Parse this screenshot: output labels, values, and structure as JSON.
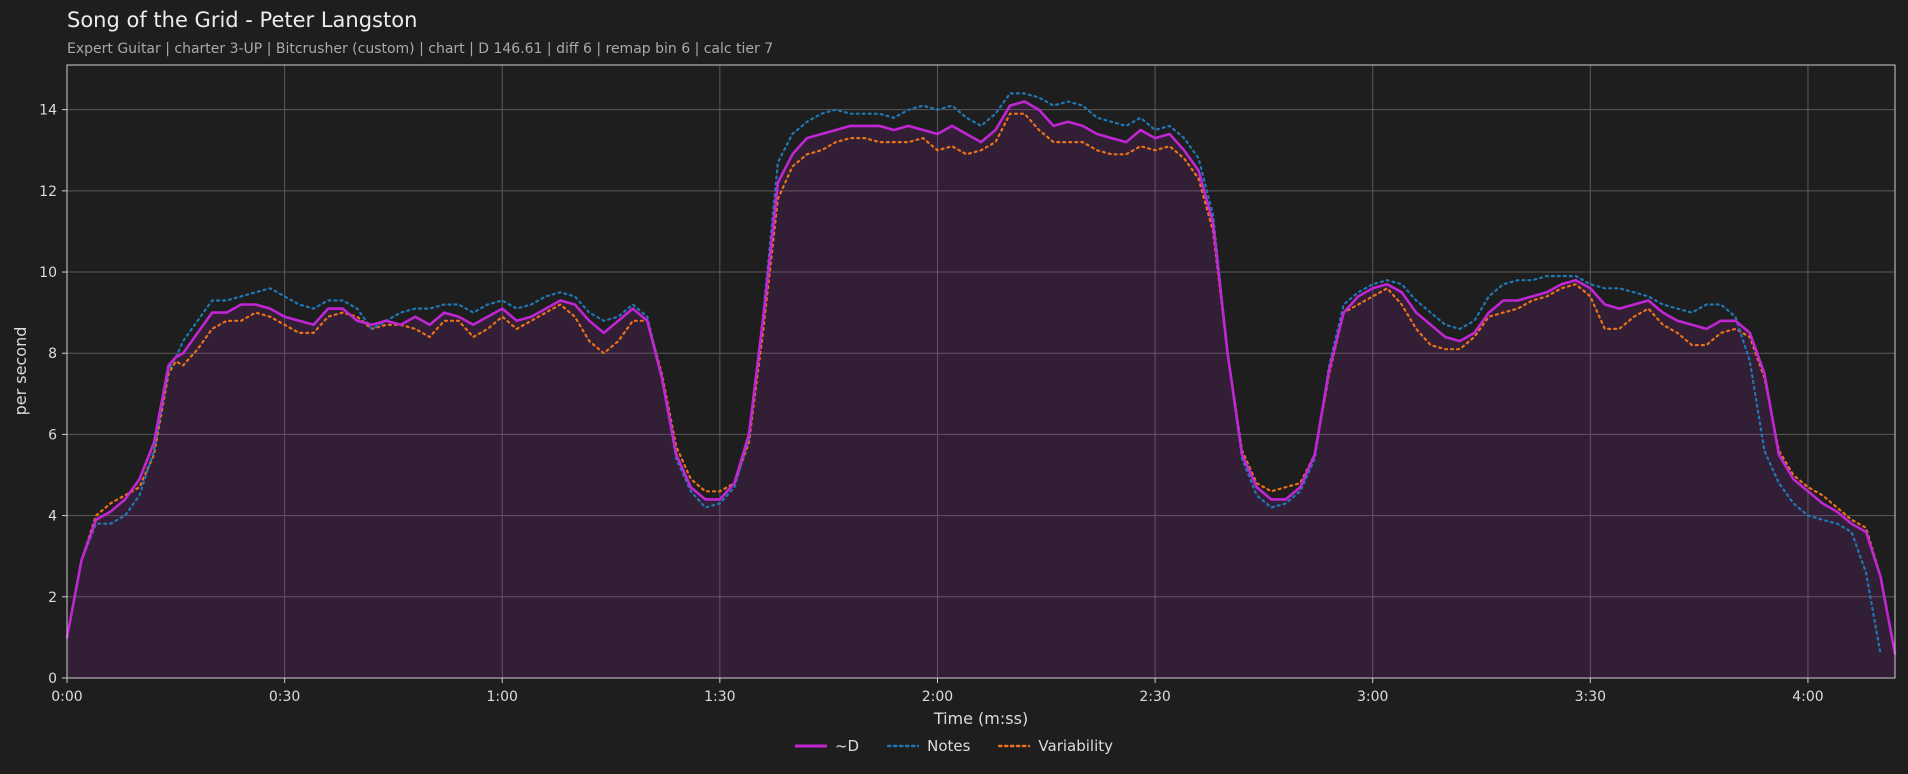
{
  "title": "Song of the Grid - Peter Langston",
  "subtitle": "Expert Guitar  |  charter 3-UP  |  Bitcrusher (custom)  |  chart  |  D 146.61  |  diff 6  |  remap bin 6  |  calc tier 7",
  "chart_data": {
    "type": "line",
    "xlabel": "Time (m:ss)",
    "ylabel": "per second",
    "xlim": [
      0,
      252
    ],
    "ylim": [
      0,
      15.1
    ],
    "x_ticks": [
      0,
      30,
      60,
      90,
      120,
      150,
      180,
      210,
      240
    ],
    "x_tick_labels": [
      "0:00",
      "0:30",
      "1:00",
      "1:30",
      "2:00",
      "2:30",
      "3:00",
      "3:30",
      "4:00"
    ],
    "y_ticks": [
      0,
      2,
      4,
      6,
      8,
      10,
      12,
      14
    ],
    "y_tick_labels": [
      "0",
      "2",
      "4",
      "6",
      "8",
      "10",
      "12",
      "14"
    ],
    "grid": true,
    "legend_position": "bottom-center",
    "x": [
      0,
      2,
      4,
      6,
      8,
      10,
      12,
      14,
      15,
      16,
      18,
      20,
      22,
      24,
      26,
      28,
      30,
      32,
      34,
      36,
      38,
      40,
      42,
      44,
      46,
      48,
      50,
      52,
      54,
      56,
      58,
      60,
      62,
      64,
      66,
      68,
      70,
      72,
      74,
      76,
      78,
      80,
      82,
      84,
      86,
      88,
      90,
      92,
      94,
      96,
      98,
      100,
      102,
      104,
      106,
      108,
      110,
      112,
      114,
      116,
      118,
      120,
      122,
      124,
      126,
      128,
      130,
      132,
      134,
      136,
      138,
      140,
      142,
      144,
      146,
      148,
      150,
      152,
      154,
      156,
      158,
      160,
      162,
      164,
      166,
      168,
      170,
      172,
      174,
      176,
      178,
      180,
      182,
      184,
      186,
      188,
      190,
      192,
      194,
      196,
      198,
      200,
      202,
      204,
      206,
      208,
      210,
      212,
      214,
      216,
      218,
      220,
      222,
      224,
      226,
      228,
      230,
      232,
      234,
      236,
      238,
      240,
      242,
      244,
      246,
      248,
      250,
      252
    ],
    "series": [
      {
        "name": "~D",
        "style": "solid",
        "color": "#c026d3",
        "values": [
          1.0,
          2.9,
          3.9,
          4.1,
          4.4,
          4.9,
          5.8,
          7.7,
          7.9,
          8.0,
          8.5,
          9.0,
          9.0,
          9.2,
          9.2,
          9.1,
          8.9,
          8.8,
          8.7,
          9.1,
          9.1,
          8.8,
          8.7,
          8.8,
          8.7,
          8.9,
          8.7,
          9.0,
          8.9,
          8.7,
          8.9,
          9.1,
          8.8,
          8.9,
          9.1,
          9.3,
          9.2,
          8.8,
          8.5,
          8.8,
          9.1,
          8.8,
          7.4,
          5.5,
          4.7,
          4.4,
          4.4,
          4.8,
          6.0,
          8.9,
          12.2,
          12.9,
          13.3,
          13.4,
          13.5,
          13.6,
          13.6,
          13.6,
          13.5,
          13.6,
          13.5,
          13.4,
          13.6,
          13.4,
          13.2,
          13.5,
          14.1,
          14.2,
          14.0,
          13.6,
          13.7,
          13.6,
          13.4,
          13.3,
          13.2,
          13.5,
          13.3,
          13.4,
          13.0,
          12.5,
          11.2,
          8.0,
          5.5,
          4.7,
          4.4,
          4.4,
          4.7,
          5.5,
          7.6,
          9.0,
          9.4,
          9.6,
          9.7,
          9.5,
          9.0,
          8.7,
          8.4,
          8.3,
          8.5,
          9.0,
          9.3,
          9.3,
          9.4,
          9.5,
          9.7,
          9.8,
          9.6,
          9.2,
          9.1,
          9.2,
          9.3,
          9.0,
          8.8,
          8.7,
          8.6,
          8.8,
          8.8,
          8.5,
          7.5,
          5.5,
          4.9,
          4.6,
          4.3,
          4.1,
          3.8,
          3.6,
          2.5,
          0.6
        ]
      },
      {
        "name": "Notes",
        "style": "dotted",
        "color": "#1f77b4",
        "values": [
          1.0,
          2.9,
          3.8,
          3.8,
          4.0,
          4.5,
          5.6,
          7.6,
          7.9,
          8.3,
          8.8,
          9.3,
          9.3,
          9.4,
          9.5,
          9.6,
          9.4,
          9.2,
          9.1,
          9.3,
          9.3,
          9.1,
          8.6,
          8.8,
          9.0,
          9.1,
          9.1,
          9.2,
          9.2,
          9.0,
          9.2,
          9.3,
          9.1,
          9.2,
          9.4,
          9.5,
          9.4,
          9.0,
          8.8,
          8.9,
          9.2,
          8.9,
          7.4,
          5.4,
          4.6,
          4.2,
          4.3,
          4.7,
          5.9,
          9.0,
          12.7,
          13.4,
          13.7,
          13.9,
          14.0,
          13.9,
          13.9,
          13.9,
          13.8,
          14.0,
          14.1,
          14.0,
          14.1,
          13.8,
          13.6,
          13.9,
          14.4,
          14.4,
          14.3,
          14.1,
          14.2,
          14.1,
          13.8,
          13.7,
          13.6,
          13.8,
          13.5,
          13.6,
          13.3,
          12.8,
          11.4,
          8.0,
          5.4,
          4.5,
          4.2,
          4.3,
          4.6,
          5.4,
          7.7,
          9.2,
          9.5,
          9.7,
          9.8,
          9.7,
          9.3,
          9.0,
          8.7,
          8.6,
          8.8,
          9.4,
          9.7,
          9.8,
          9.8,
          9.9,
          9.9,
          9.9,
          9.7,
          9.6,
          9.6,
          9.5,
          9.4,
          9.2,
          9.1,
          9.0,
          9.2,
          9.2,
          8.9,
          7.8,
          5.6,
          4.8,
          4.3,
          4.0,
          3.9,
          3.8,
          3.6,
          2.6,
          0.6
        ]
      },
      {
        "name": "Variability",
        "style": "dotted",
        "color": "#e8711a",
        "values": [
          1.0,
          2.9,
          4.0,
          4.3,
          4.5,
          4.7,
          5.5,
          7.5,
          7.8,
          7.7,
          8.1,
          8.6,
          8.8,
          8.8,
          9.0,
          8.9,
          8.7,
          8.5,
          8.5,
          8.9,
          9.0,
          8.9,
          8.6,
          8.7,
          8.7,
          8.6,
          8.4,
          8.8,
          8.8,
          8.4,
          8.6,
          8.9,
          8.6,
          8.8,
          9.0,
          9.2,
          8.9,
          8.3,
          8.0,
          8.3,
          8.8,
          8.8,
          7.5,
          5.7,
          4.9,
          4.6,
          4.6,
          4.8,
          5.8,
          8.6,
          11.8,
          12.6,
          12.9,
          13.0,
          13.2,
          13.3,
          13.3,
          13.2,
          13.2,
          13.2,
          13.3,
          13.0,
          13.1,
          12.9,
          13.0,
          13.2,
          13.9,
          13.9,
          13.5,
          13.2,
          13.2,
          13.2,
          13.0,
          12.9,
          12.9,
          13.1,
          13.0,
          13.1,
          12.8,
          12.3,
          11.0,
          8.0,
          5.6,
          4.8,
          4.6,
          4.7,
          4.8,
          5.5,
          7.5,
          9.0,
          9.2,
          9.4,
          9.6,
          9.2,
          8.6,
          8.2,
          8.1,
          8.1,
          8.4,
          8.9,
          9.0,
          9.1,
          9.3,
          9.4,
          9.6,
          9.7,
          9.4,
          8.6,
          8.6,
          8.9,
          9.1,
          8.7,
          8.5,
          8.2,
          8.2,
          8.5,
          8.6,
          8.4,
          7.4,
          5.6,
          5.0,
          4.7,
          4.5,
          4.2,
          3.9,
          3.7,
          2.5,
          0.6
        ]
      }
    ]
  }
}
